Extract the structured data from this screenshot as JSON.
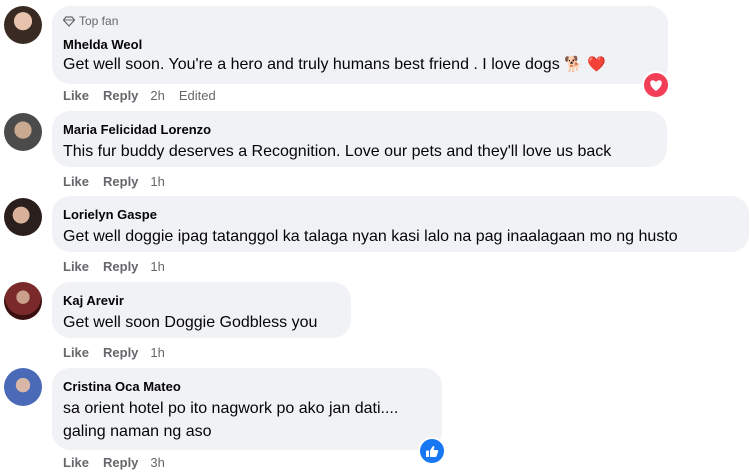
{
  "comments": [
    {
      "badge": "Top fan",
      "author": "Mhelda Weol",
      "text": "Get well soon. You're a hero and truly humans best friend . I love dogs",
      "emojis": "🐕 ❤️",
      "like": "Like",
      "reply": "Reply",
      "time": "2h",
      "edited": "Edited",
      "reaction": "love-reaction-icon"
    },
    {
      "author": "Maria Felicidad Lorenzo",
      "text": "This fur buddy deserves a Recognition. Love our pets and they'll love us back",
      "like": "Like",
      "reply": "Reply",
      "time": "1h"
    },
    {
      "author": "Lorielyn Gaspe",
      "text": "Get well doggie ipag tatanggol ka talaga nyan kasi lalo na pag inaalagaan mo ng husto",
      "like": "Like",
      "reply": "Reply",
      "time": "1h"
    },
    {
      "author": "Kaj Arevir",
      "text": "Get well soon Doggie Godbless you",
      "like": "Like",
      "reply": "Reply",
      "time": "1h"
    },
    {
      "author": "Cristina Oca Mateo",
      "text_line1": "sa orient hotel po ito nagwork po ako jan dati....",
      "text_line2": "galing naman ng aso",
      "like": "Like",
      "reply": "Reply",
      "time": "3h",
      "reaction": "like-reaction-icon"
    }
  ],
  "colors": {
    "bubble": "#f0f2f5",
    "secondary_text": "#65676b",
    "love": "#f33e58",
    "like": "#1877f2"
  }
}
